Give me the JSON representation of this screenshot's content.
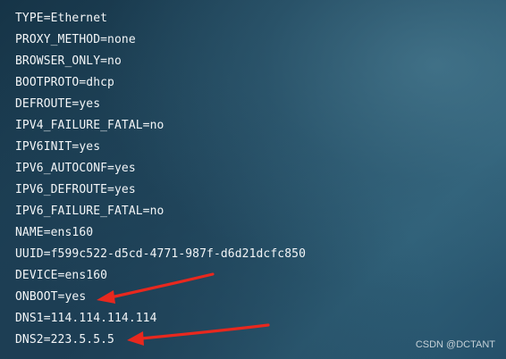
{
  "config_lines": [
    "TYPE=Ethernet",
    "PROXY_METHOD=none",
    "BROWSER_ONLY=no",
    "BOOTPROTO=dhcp",
    "DEFROUTE=yes",
    "IPV4_FAILURE_FATAL=no",
    "IPV6INIT=yes",
    "IPV6_AUTOCONF=yes",
    "IPV6_DEFROUTE=yes",
    "IPV6_FAILURE_FATAL=no",
    "NAME=ens160",
    "UUID=f599c522-d5cd-4771-987f-d6d21dcfc850",
    "DEVICE=ens160",
    "ONBOOT=yes",
    "DNS1=114.114.114.114",
    "DNS2=223.5.5.5"
  ],
  "watermark": "CSDN @DCTANT",
  "colors": {
    "text": "#f2f5f7",
    "arrow": "#e8281e"
  }
}
